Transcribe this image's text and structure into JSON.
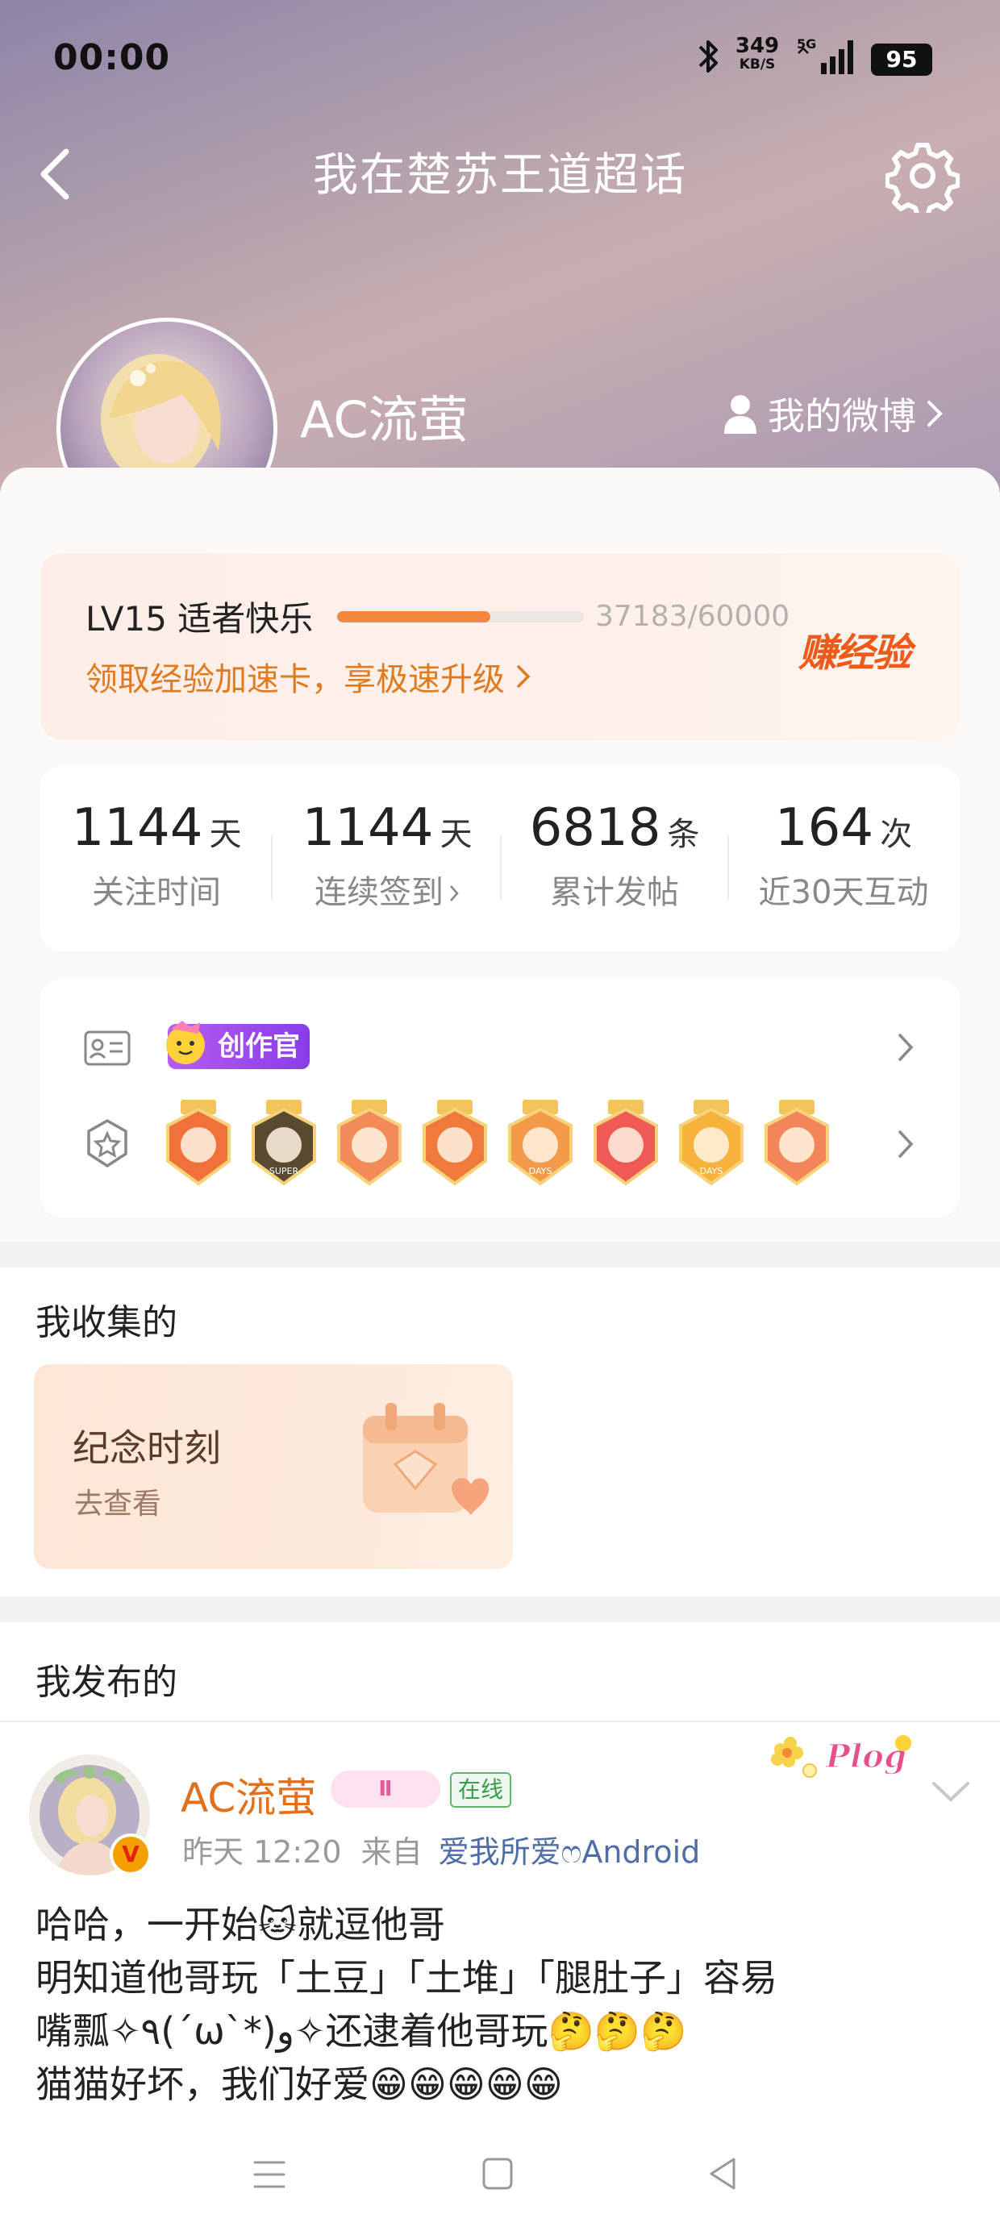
{
  "status_bar": {
    "time": "00:00",
    "net_speed": "349",
    "net_unit": "KB/S",
    "signal": "5G",
    "battery": "95"
  },
  "nav": {
    "title": "我在楚苏王道超话",
    "back_icon": "chevron-left-icon",
    "settings_icon": "gear-icon"
  },
  "profile": {
    "username": "AC流萤",
    "my_weibo": "我的微博",
    "verified_badge": "V"
  },
  "level": {
    "label": "LV15 适者快乐",
    "progress_text": "37183/60000",
    "progress_current": 37183,
    "progress_total": 60000,
    "boost_link": "领取经验加速卡，享极速升级",
    "earn_label": "赚经验"
  },
  "stats": [
    {
      "value": "1144",
      "unit": "天",
      "label": "关注时间",
      "has_chevron": false
    },
    {
      "value": "1144",
      "unit": "天",
      "label": "连续签到",
      "has_chevron": true
    },
    {
      "value": "6818",
      "unit": "条",
      "label": "累计发帖",
      "has_chevron": false
    },
    {
      "value": "164",
      "unit": "次",
      "label": "近30天互动",
      "has_chevron": false
    }
  ],
  "identity": {
    "creator_tag": "创作官"
  },
  "medals": [
    {
      "name": "fox-medal",
      "color": "#f2703a",
      "text": ""
    },
    {
      "name": "super-medal",
      "color": "#5a4a32",
      "text": "SUPER"
    },
    {
      "name": "cat-medal",
      "color": "#f28a5a",
      "text": ""
    },
    {
      "name": "crown-fox-medal",
      "color": "#f07a3c",
      "text": ""
    },
    {
      "name": "100-days-medal",
      "color": "#f39a4a",
      "text": "DAYS"
    },
    {
      "name": "trophy-medal",
      "color": "#ef5a55",
      "text": ""
    },
    {
      "name": "30-days-medal",
      "color": "#f6b23a",
      "text": "DAYS"
    },
    {
      "name": "hand-medal",
      "color": "#f4845a",
      "text": ""
    }
  ],
  "collection": {
    "section_title": "我收集的",
    "card_title": "纪念时刻",
    "card_sub": "去查看"
  },
  "posts": {
    "section_title": "我发布的",
    "author": "AC流萤",
    "level_tag": "Ⅱ",
    "online": "在线",
    "time": "昨天 12:20",
    "from_label": "来自",
    "source": "爱我所爱ෆAndroid",
    "sticker_text": "Plog",
    "lines": [
      "哈哈，一开始🐱就逗他哥",
      "明知道他哥玩「土豆」「土堆」「腿肚子」容易",
      "嘴瓢✧٩(ˊωˋ*)و✧还逮着他哥玩🤔🤔🤔",
      "猫猫好坏，我们好爱😁😁😁😁😁"
    ]
  },
  "colors": {
    "accent_orange": "#f2873d",
    "name_orange": "#e36f1d",
    "link_blue": "#4f6ea8",
    "creator_purple": "#9a48ec"
  }
}
